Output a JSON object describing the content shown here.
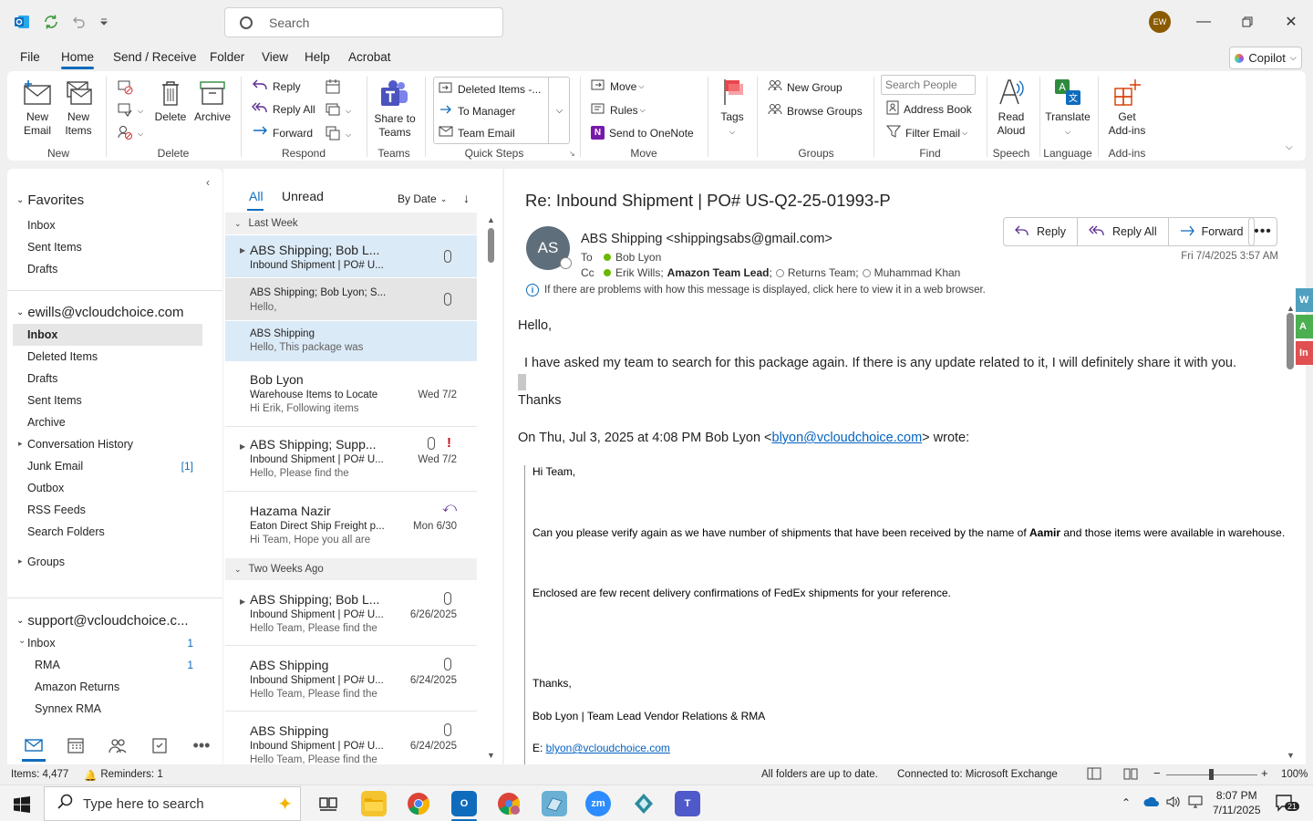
{
  "titlebar": {
    "search_placeholder": "Search",
    "avatar_initials": "EW"
  },
  "menu": {
    "tabs": [
      "File",
      "Home",
      "Send / Receive",
      "Folder",
      "View",
      "Help",
      "Acrobat"
    ],
    "active_tab": "Home",
    "copilot_label": "Copilot"
  },
  "ribbon": {
    "new_email": "New Email",
    "new_items": "New Items",
    "group_new": "New",
    "delete": "Delete",
    "archive": "Archive",
    "group_delete": "Delete",
    "reply": "Reply",
    "reply_all": "Reply All",
    "forward": "Forward",
    "group_respond": "Respond",
    "share_to_teams": "Share to Teams",
    "group_teams": "Teams",
    "qs_deleted_items": "Deleted Items -...",
    "qs_to_manager": "To Manager",
    "qs_team_email": "Team Email",
    "group_quick_steps": "Quick Steps",
    "move": "Move",
    "rules": "Rules",
    "send_to_onenote": "Send to OneNote",
    "group_move": "Move",
    "tags": "Tags",
    "new_group": "New Group",
    "browse_groups": "Browse Groups",
    "group_groups": "Groups",
    "search_people_placeholder": "Search People",
    "address_book": "Address Book",
    "filter_email": "Filter Email",
    "group_find": "Find",
    "read_aloud": "Read Aloud",
    "group_speech": "Speech",
    "translate": "Translate",
    "group_language": "Language",
    "get_addins": "Get Add-ins",
    "group_addins": "Add-ins"
  },
  "nav": {
    "favorites_label": "Favorites",
    "favorites": [
      "Inbox",
      "Sent Items",
      "Drafts"
    ],
    "account1": "ewills@vcloudchoice.com",
    "account1_folders": [
      "Inbox",
      "Deleted Items",
      "Drafts",
      "Sent Items",
      "Archive",
      "Conversation History",
      "Junk Email",
      "Outbox",
      "RSS Feeds",
      "Search Folders"
    ],
    "junk_count": "[1]",
    "groups_label": "Groups",
    "account2": "support@vcloudchoice.c...",
    "account2_inbox": "Inbox",
    "account2_inbox_count": "1",
    "account2_subfolders": [
      "RMA",
      "Amazon Returns",
      "Synnex RMA"
    ],
    "rma_count": "1"
  },
  "msglist": {
    "filter_all": "All",
    "filter_unread": "Unread",
    "sort_label": "By Date",
    "group_last_week": "Last Week",
    "group_two_weeks": "Two Weeks Ago",
    "items": [
      {
        "sender": "ABS Shipping;  Bob L...",
        "subject": "Inbound Shipment | PO# U...",
        "preview": "",
        "date": ""
      },
      {
        "sender": "ABS Shipping;  Bob Lyon;  S...",
        "subject": "",
        "preview": "Hello,",
        "date": ""
      },
      {
        "sender": "ABS Shipping",
        "subject": "",
        "preview": "Hello,  This package was",
        "date": ""
      },
      {
        "sender": "Bob Lyon",
        "subject": "Warehouse Items to Locate",
        "preview": "Hi Erik,  Following items",
        "date": "Wed 7/2"
      },
      {
        "sender": "ABS Shipping;  Supp...",
        "subject": "Inbound Shipment | PO# U...",
        "preview": "Hello,  Please find the",
        "date": "Wed 7/2"
      },
      {
        "sender": "Hazama Nazir",
        "subject": "Eaton Direct Ship Freight p...",
        "preview": "Hi Team,  Hope you all are",
        "date": "Mon 6/30"
      },
      {
        "sender": "ABS Shipping;  Bob L...",
        "subject": "Inbound Shipment | PO# U...",
        "preview": "Hello Team,  Please find the",
        "date": "6/26/2025"
      },
      {
        "sender": "ABS Shipping",
        "subject": "Inbound Shipment | PO# U...",
        "preview": "Hello Team,  Please find the",
        "date": "6/24/2025"
      },
      {
        "sender": "ABS Shipping",
        "subject": "Inbound Shipment | PO# U...",
        "preview": "Hello Team,  Please find the",
        "date": "6/24/2025"
      }
    ]
  },
  "reading": {
    "subject": "Re: Inbound Shipment | PO# US-Q2-25-01993-P",
    "avatar_initials": "AS",
    "from": "ABS Shipping <shippingsabs@gmail.com>",
    "to_label": "To",
    "to": "Bob Lyon",
    "cc_label": "Cc",
    "cc_1": "Erik Wills;",
    "cc_2": "Amazon Team Lead",
    "cc_2_sep": ";",
    "cc_3": "Returns Team;",
    "cc_4": "Muhammad Khan",
    "btn_reply": "Reply",
    "btn_reply_all": "Reply All",
    "btn_forward": "Forward",
    "date": "Fri 7/4/2025 3:57 AM",
    "info": "If there are problems with how this message is displayed, click here to view it in a web browser.",
    "greeting": "Hello,",
    "para1": "I have asked my team to search for this package again. If there is any update related to it, I will definitely share it with you.",
    "thanks": "Thanks",
    "quote_header_pre": "On Thu, Jul 3, 2025 at 4:08 PM Bob Lyon <",
    "quote_header_email": "blyon@vcloudchoice.com",
    "quote_header_post": "> wrote:",
    "q_hi": "Hi Team,",
    "q_line1_a": "Can you please verify again as we have number of shipments that have been received by the name of ",
    "q_line1_bold": "Aamir",
    "q_line1_b": " and those items were available in warehouse.",
    "q_line2": "Enclosed are few recent delivery confirmations of FedEx shipments for your reference.",
    "q_thanks": "Thanks,",
    "q_sig": "Bob Lyon | Team Lead Vendor Relations & RMA",
    "q_email_label": "E: ",
    "q_email": "blyon@vcloudchoice.com"
  },
  "side_strip": [
    "W",
    "A",
    "In"
  ],
  "status": {
    "items": "Items: 4,477",
    "reminders": "Reminders: 1",
    "sync": "All folders are up to date.",
    "connected": "Connected to: Microsoft Exchange",
    "zoom": "100%"
  },
  "taskbar": {
    "search_placeholder": "Type here to search",
    "time": "8:07 PM",
    "date": "7/11/2025",
    "notif_count": "21"
  }
}
